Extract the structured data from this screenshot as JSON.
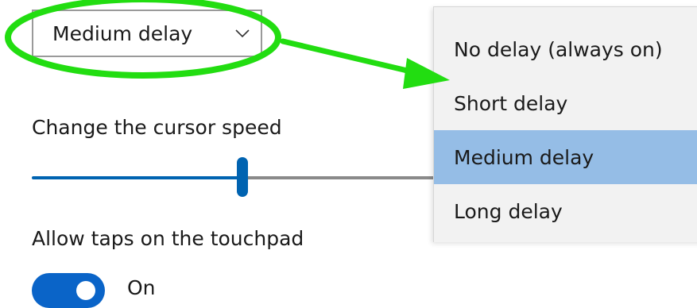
{
  "delay_select": {
    "value": "Medium delay",
    "chevron_icon": "chevron-down-icon"
  },
  "cursor_speed": {
    "label": "Change the cursor speed",
    "value_fraction": 0.51
  },
  "taps": {
    "label": "Allow taps on the touchpad",
    "toggle_state": "On",
    "toggle_on": true
  },
  "dropdown": {
    "options": [
      "No delay (always on)",
      "Short delay",
      "Medium delay",
      "Long delay"
    ],
    "selected_index": 2
  },
  "colors": {
    "accent": "#0063b1",
    "toggle_on": "#0a64c8",
    "selected_option": "#95bde6",
    "annotation": "#22dd11"
  }
}
